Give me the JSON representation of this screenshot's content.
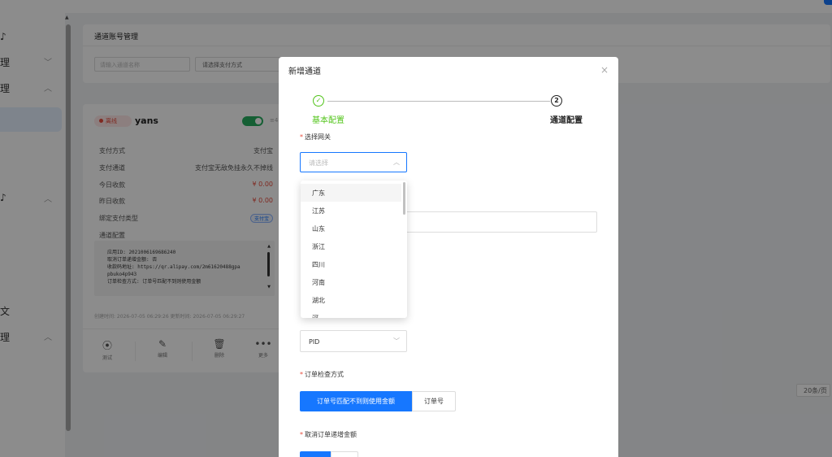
{
  "sidebar": {
    "glyphs": [
      "♪",
      "理",
      "理",
      "♪",
      "文",
      "理"
    ],
    "chevrons": [
      "﹀",
      "︿",
      "︿",
      "︿"
    ]
  },
  "panel": {
    "title": "通道账号管理",
    "search_placeholder": "请输入通道名称",
    "pay_select_placeholder": "请选择支付方式"
  },
  "card": {
    "status": "离线",
    "name": "yans",
    "toggle_on": true,
    "toggle_fragment": "≡4",
    "rows": [
      {
        "label": "支付方式",
        "value": "支付宝"
      },
      {
        "label": "支付通道",
        "value": "支付宝无敌免挂永久不掉线"
      },
      {
        "label": "今日收款",
        "value": "¥ 0.00"
      },
      {
        "label": "昨日收款",
        "value": "¥ 0.00"
      },
      {
        "label": "绑定支付类型",
        "value": "支付宝"
      },
      {
        "label": "通道配置",
        "value": ""
      }
    ],
    "config_lines": [
      "应用ID: 2021006169686240",
      "取消订单递增金额: 否",
      "收款码地址: https://qr.alipay.com/2m61620488gpa",
      "pbuko4p943",
      "订单检查方式: 订单号匹配不到则使用金额"
    ],
    "timeline": "创建时间: 2026-07-05 06:29:26 更新时间: 2026-07-05 06:29:27",
    "actions": [
      {
        "label": "测试",
        "icon": "⦿"
      },
      {
        "label": "编辑",
        "icon": "✎"
      },
      {
        "label": "删除",
        "icon": "🗑"
      },
      {
        "label": "更多",
        "icon": "•••"
      }
    ]
  },
  "pagination": {
    "page_size": "20条/页"
  },
  "modal": {
    "title": "新增通道",
    "close": "×",
    "steps": [
      {
        "label": "基本配置",
        "marker": "✓",
        "status": "done"
      },
      {
        "label": "通道配置",
        "marker": "2",
        "status": "current"
      }
    ],
    "gateway_label": "选择网关",
    "gateway_placeholder": "请选择",
    "pid_value": "PID",
    "check_method_label": "订单检查方式",
    "check_method_options": [
      "订单号匹配不到则使用金额",
      "订单号"
    ],
    "cancel_increase_label": "取消订单递增金额"
  },
  "dropdown": {
    "options": [
      "广东",
      "江苏",
      "山东",
      "浙江",
      "四川",
      "河南",
      "湖北",
      "河"
    ]
  },
  "colors": {
    "primary": "#1677ff",
    "success": "#52c41a",
    "danger": "#e74c3c",
    "toggle": "#27ae60"
  }
}
